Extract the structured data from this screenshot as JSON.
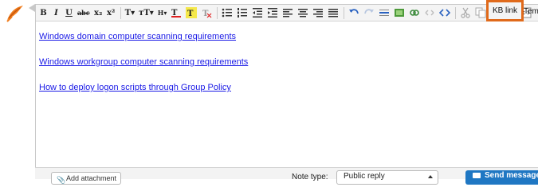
{
  "app": {
    "logo_icon": "quill-icon"
  },
  "toolbar": {
    "buttons": [
      "B",
      "I",
      "U",
      "abc",
      "x₂",
      "x²",
      "T▾",
      "ᴛT▾",
      "H▾"
    ],
    "kb_link_label": "KB link",
    "templates_label": "Tem",
    "highlight_color": "#e06a1b"
  },
  "content": {
    "links": [
      "Windows domain computer scanning requirements",
      "Windows workgroup computer scanning requirements",
      "How to deploy logon scripts through Group Policy"
    ]
  },
  "footer": {
    "attachment_label": "Add attachment",
    "note_type_label": "Note type:",
    "note_type_value": "Public reply",
    "send_label": "Send message"
  }
}
